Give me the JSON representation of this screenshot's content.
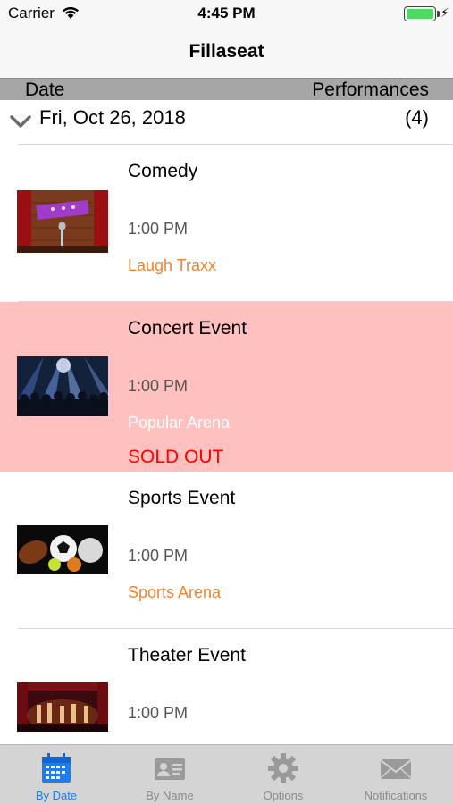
{
  "status_bar": {
    "carrier": "Carrier",
    "time": "4:45 PM"
  },
  "nav": {
    "title": "Fillaseat"
  },
  "columns": {
    "date": "Date",
    "performances": "Performances"
  },
  "section": {
    "date": "Fri, Oct 26, 2018",
    "count": "(4)"
  },
  "events": [
    {
      "title": "Comedy",
      "time": "1:00 PM",
      "venue": "Laugh Traxx",
      "image": "comedy-stage-image"
    },
    {
      "title": "Concert Event",
      "time": "1:00 PM",
      "venue": "Popular Arena",
      "status": "SOLD OUT",
      "image": "concert-crowd-image"
    },
    {
      "title": "Sports Event",
      "time": "1:00 PM",
      "venue": "Sports Arena",
      "image": "sports-balls-image"
    },
    {
      "title": "Theater Event",
      "time": "1:00 PM",
      "image": "theater-stage-image"
    }
  ],
  "tabs": [
    {
      "label": "By Date",
      "icon": "calendar-icon",
      "active": true
    },
    {
      "label": "By Name",
      "icon": "contact-card-icon",
      "active": false
    },
    {
      "label": "Options",
      "icon": "gear-icon",
      "active": false
    },
    {
      "label": "Notifications",
      "icon": "envelope-icon",
      "active": false
    }
  ],
  "colors": {
    "venue": "#f0832f",
    "sold_row": "#ffc0c0",
    "sold_text": "#ff0000",
    "active_tab": "#1e7cf0"
  }
}
